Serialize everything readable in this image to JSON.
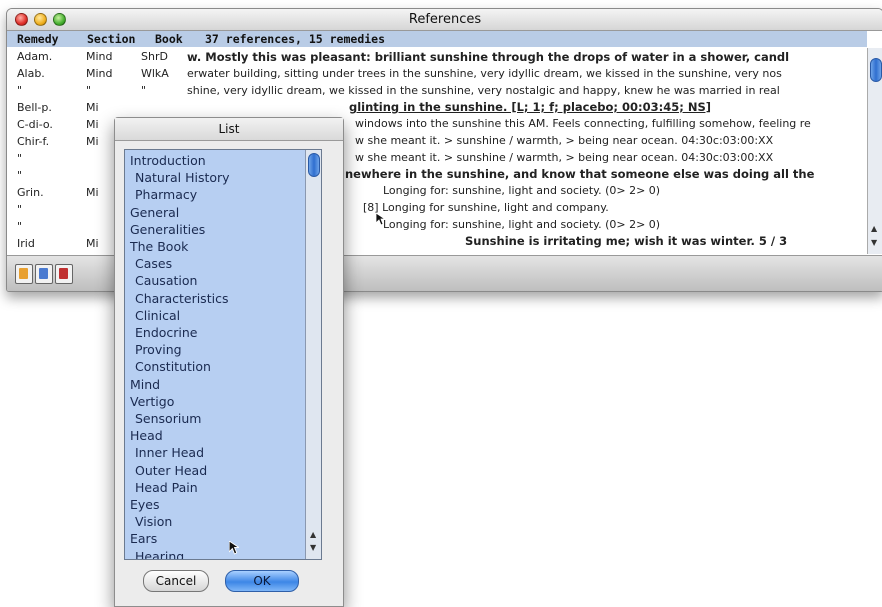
{
  "window": {
    "title": "References"
  },
  "header": {
    "col_remedy": "Remedy",
    "col_section": "Section",
    "col_book": "Book",
    "summary": "37 references, 15 remedies"
  },
  "rows": [
    {
      "remedy": "Adam.",
      "section": "Mind",
      "book": "ShrD"
    },
    {
      "remedy": "Alab.",
      "section": "Mind",
      "book": "WlkA"
    },
    {
      "remedy": "\"",
      "section": "\"",
      "book": "\""
    },
    {
      "remedy": "Bell-p.",
      "section": "Mi",
      "book": ""
    },
    {
      "remedy": "C-di-o.",
      "section": "Mi",
      "book": ""
    },
    {
      "remedy": "Chir-f.",
      "section": "Mi",
      "book": ""
    },
    {
      "remedy": "\"",
      "section": "",
      "book": ""
    },
    {
      "remedy": "\"",
      "section": "",
      "book": ""
    },
    {
      "remedy": "Grin.",
      "section": "Mi",
      "book": ""
    },
    {
      "remedy": "\"",
      "section": "",
      "book": ""
    },
    {
      "remedy": "\"",
      "section": "",
      "book": ""
    },
    {
      "remedy": "Irid",
      "section": "Mi",
      "book": ""
    }
  ],
  "text_lines": [
    "w. Mostly this was pleasant: brilliant sunshine through the drops of water in a shower, candl",
    "erwater building, sitting under trees in the sunshine, very idyllic dream, we kissed in the sunshine, very nos",
    "shine, very idyllic dream, we kissed in the sunshine, very nostalgic and happy, knew he was married in real",
    "glinting in the sunshine. [L; 1; f; placebo; 00:03:45; NS]",
    "windows into the sunshine this AM. Feels connecting, fulfilling somehow, feeling re",
    "w she meant it. > sunshine / warmth, > being near ocean. 04:30c:03:00:XX",
    "w she meant it. > sunshine / warmth, > being near ocean. 04:30c:03:00:XX",
    "newhere in the sunshine, and know that someone else was doing all the",
    "Longing for: sunshine, light and society. (0> 2> 0)",
    "[8] Longing for sunshine, light and company.",
    "Longing for: sunshine, light and society. (0> 2> 0)",
    "Sunshine is irritating me; wish it was winter. 5 / 3"
  ],
  "list_dialog": {
    "title": "List",
    "items": [
      {
        "label": "Introduction",
        "sub": false
      },
      {
        "label": "Natural History",
        "sub": true
      },
      {
        "label": "Pharmacy",
        "sub": true
      },
      {
        "label": "General",
        "sub": false
      },
      {
        "label": "Generalities",
        "sub": false
      },
      {
        "label": "The Book",
        "sub": false
      },
      {
        "label": "Cases",
        "sub": true
      },
      {
        "label": "Causation",
        "sub": true
      },
      {
        "label": "Characteristics",
        "sub": true
      },
      {
        "label": "Clinical",
        "sub": true
      },
      {
        "label": "Endocrine",
        "sub": true
      },
      {
        "label": "Proving",
        "sub": true
      },
      {
        "label": "Constitution",
        "sub": true
      },
      {
        "label": "Mind",
        "sub": false
      },
      {
        "label": "Vertigo",
        "sub": false
      },
      {
        "label": "Sensorium",
        "sub": true
      },
      {
        "label": "Head",
        "sub": false
      },
      {
        "label": "Inner Head",
        "sub": true
      },
      {
        "label": "Outer Head",
        "sub": true
      },
      {
        "label": "Head Pain",
        "sub": true
      },
      {
        "label": "Eyes",
        "sub": false
      },
      {
        "label": "Vision",
        "sub": true
      },
      {
        "label": "Ears",
        "sub": false
      },
      {
        "label": "Hearing",
        "sub": true
      }
    ],
    "cancel_label": "Cancel",
    "ok_label": "OK"
  },
  "toolbar": {
    "icons": [
      "book-icon",
      "bottle-icon",
      "remedy-icon"
    ],
    "colors": [
      "#e8a030",
      "#4a7ad0",
      "#c03030"
    ]
  }
}
